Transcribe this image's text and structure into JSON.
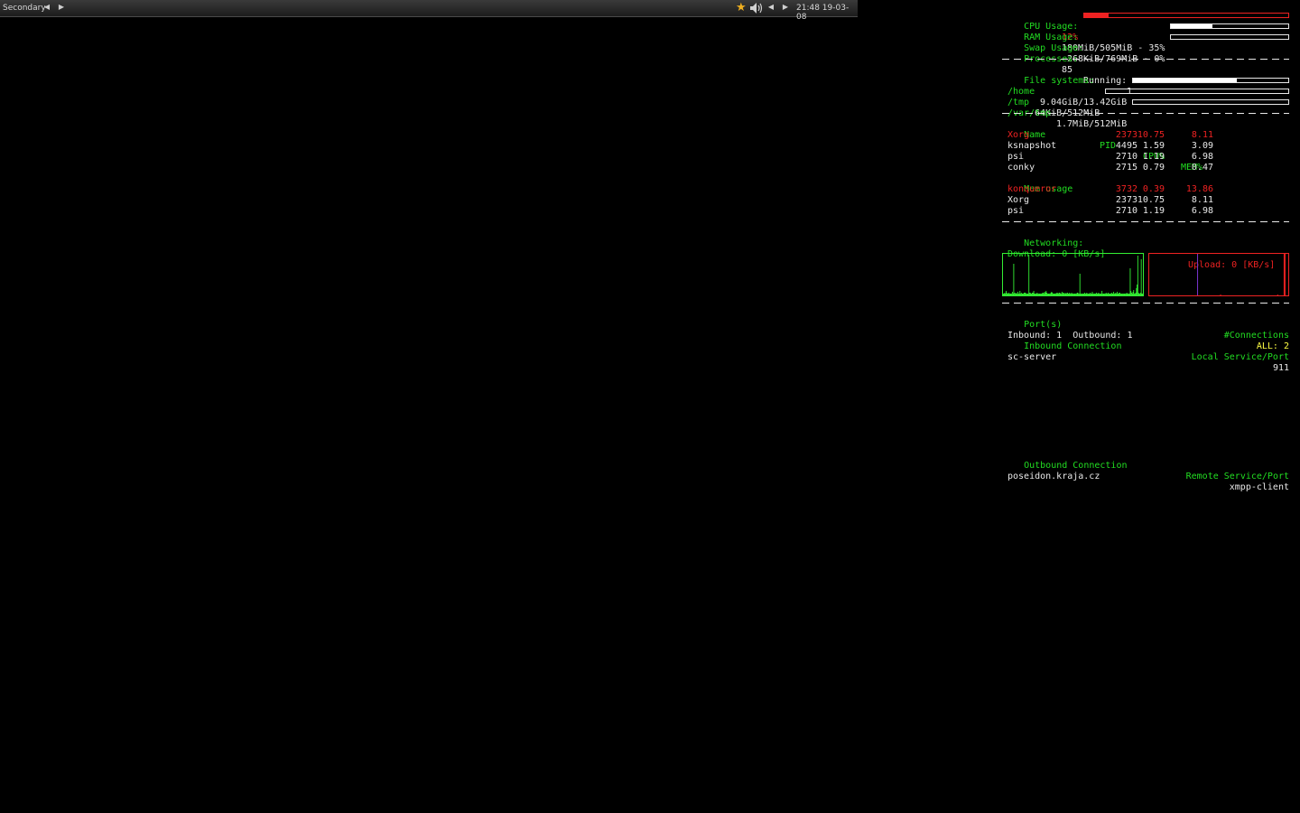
{
  "panel": {
    "workspace": "Secondary",
    "clock": "21:48 19-03-08",
    "icons": [
      "left-arrow-icon",
      "right-arrow-icon",
      "star-icon",
      "volume-icon"
    ]
  },
  "conky": {
    "cpu": {
      "label": "CPU Usage:",
      "value": "12%",
      "percent": 12
    },
    "ram": {
      "label": "RAM Usage:",
      "value": "180MiB/505MiB - 35%",
      "percent": 35
    },
    "swap": {
      "label": "Swap Usage:",
      "value": "268KiB/769MiB - 0%",
      "percent": 0
    },
    "processes": {
      "label": "Processes:",
      "value": "85",
      "running_label": "Running:",
      "running": "1"
    },
    "filesystems": {
      "label": "File systems:",
      "items": [
        {
          "path": "/home",
          "usage": "9.04GiB/13.42GiB",
          "percent": 67
        },
        {
          "path": "/tmp",
          "usage": "64KiB/512MiB",
          "percent": 0
        },
        {
          "path": "/var/tmp",
          "usage": "1.7MiB/512MiB",
          "percent": 0
        }
      ]
    },
    "top_cpu": {
      "headers": {
        "name": "Name",
        "pid": "PID",
        "cpu": "CPU%",
        "mem": "MEM%"
      },
      "rows": [
        {
          "name": "Xorg",
          "pid": "2373",
          "cpu": "10.75",
          "mem": "8.11",
          "highlight": true
        },
        {
          "name": "ksnapshot",
          "pid": "4495",
          "cpu": "1.59",
          "mem": "3.09"
        },
        {
          "name": "psi",
          "pid": "2710",
          "cpu": "1.19",
          "mem": "6.98"
        },
        {
          "name": "conky",
          "pid": "2715",
          "cpu": "0.79",
          "mem": "0.47"
        }
      ]
    },
    "top_mem": {
      "label": "Mem usage",
      "rows": [
        {
          "name": "konqueror",
          "pid": "3732",
          "cpu": "0.39",
          "mem": "13.86",
          "highlight": true
        },
        {
          "name": "Xorg",
          "pid": "2373",
          "cpu": "10.75",
          "mem": "8.11"
        },
        {
          "name": "psi",
          "pid": "2710",
          "cpu": "1.19",
          "mem": "6.98"
        }
      ]
    },
    "networking": {
      "label": "Networking:",
      "download": "Download: 0 [KB/s]",
      "upload": "Upload: 0 [KB/s]",
      "download_samples": [
        2,
        2,
        3,
        2,
        5,
        3,
        2,
        2,
        3,
        2,
        2,
        2,
        2,
        4,
        2,
        35,
        3,
        2,
        3,
        2,
        2,
        4,
        2,
        2,
        5,
        2,
        3,
        2,
        2,
        2,
        3,
        3,
        3,
        2,
        2,
        2,
        2,
        45,
        3,
        3,
        2,
        2,
        3,
        3,
        5,
        2,
        2,
        2,
        2,
        3,
        2,
        2,
        2,
        2,
        2,
        2,
        2,
        3,
        3,
        2,
        4,
        3,
        5,
        3,
        2,
        2,
        2,
        2,
        2,
        3,
        4,
        3,
        2,
        2,
        2,
        2,
        2,
        3,
        2,
        3,
        2,
        3,
        3,
        2,
        2,
        4,
        3,
        2,
        3,
        2,
        2,
        3,
        2,
        3,
        2,
        2,
        3,
        2,
        2,
        3,
        2,
        2,
        2,
        2,
        2,
        2,
        2,
        3,
        3,
        2,
        2,
        24,
        2,
        2,
        2,
        2,
        2,
        2,
        3,
        2,
        2,
        3,
        2,
        2,
        2,
        2,
        3,
        2,
        2,
        4,
        2,
        2,
        2,
        2,
        2,
        3,
        2,
        2,
        3,
        2,
        2,
        2,
        2,
        5,
        2,
        2,
        2,
        2,
        2,
        3,
        2,
        2,
        3,
        2,
        2,
        2,
        2,
        3,
        2,
        2,
        4,
        2,
        2,
        3,
        2,
        4,
        2,
        2,
        3,
        3,
        2,
        2,
        2,
        2,
        2,
        2,
        2,
        2,
        2,
        3,
        2,
        2,
        2,
        2,
        30,
        5,
        3,
        2,
        4,
        6,
        2,
        2,
        3,
        8,
        12,
        44,
        3,
        2,
        2,
        3,
        40,
        2,
        2
      ],
      "upload_samples": [
        0,
        0,
        0,
        0,
        0,
        0,
        0,
        0,
        0,
        0,
        0,
        0,
        0,
        0,
        0,
        0,
        0,
        0,
        0,
        0,
        0,
        0,
        0,
        0,
        0,
        0,
        0,
        0,
        0,
        0,
        0,
        0,
        0,
        0,
        0,
        0,
        0,
        0,
        0,
        0,
        0,
        0,
        0,
        0,
        0,
        0,
        0,
        0,
        0,
        0,
        0,
        0,
        46,
        0,
        0,
        0,
        0,
        0,
        0,
        0,
        0,
        0,
        0,
        0,
        0,
        0,
        0,
        0,
        0,
        0,
        0,
        0,
        0,
        0,
        0,
        0,
        0,
        1,
        0,
        0,
        0,
        0,
        0,
        0,
        0,
        0,
        0,
        0,
        0,
        0,
        0,
        0,
        0,
        0,
        0,
        0,
        0,
        0,
        0,
        0,
        0,
        0,
        0,
        0,
        0,
        0,
        0,
        0,
        0,
        0,
        0,
        0,
        0,
        0,
        0,
        0,
        0,
        0,
        0,
        0,
        0,
        0,
        0,
        0,
        0,
        0,
        0,
        0,
        0,
        0,
        0,
        0,
        0,
        0,
        0,
        0,
        0,
        0,
        0,
        1,
        0,
        0,
        0,
        0,
        0,
        0,
        46,
        46,
        0,
        0,
        0
      ]
    },
    "ports": {
      "label": "Port(s)",
      "connections_label": "#Connections",
      "counts": "Inbound: 1  Outbound: 1",
      "all": "ALL: 2",
      "inbound_label": "Inbound Connection",
      "local_label": "Local Service/Port",
      "inbound": [
        {
          "host": "sc-server",
          "port": "911"
        }
      ],
      "outbound_label": "Outbound Connection",
      "remote_label": "Remote Service/Port",
      "outbound": [
        {
          "host": "poseidon.kraja.cz",
          "port": "xmpp-client"
        }
      ]
    },
    "colors": {
      "label": "#22dd22",
      "highlight": "#ee2222",
      "text": "#e8e8e8",
      "download_graph": "#33ee33",
      "upload_graph": "#ee2222",
      "upload_peak": "#7733cc"
    }
  }
}
